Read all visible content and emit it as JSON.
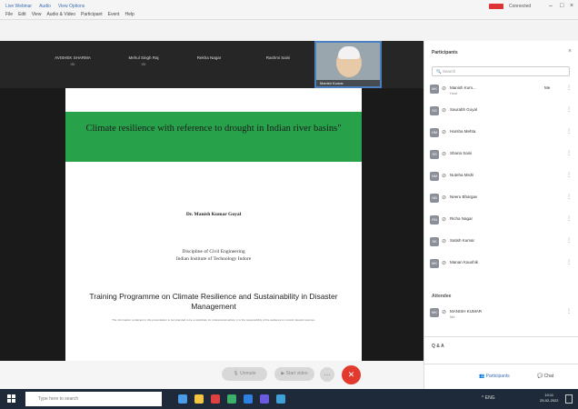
{
  "titlebar": {
    "tabs": [
      "Live Webinar",
      "Audio",
      "View Options"
    ],
    "menu": [
      "File",
      "Edit",
      "View",
      "Audio & Video",
      "Participant",
      "Event",
      "Help"
    ],
    "user": "Connected"
  },
  "video_strip": {
    "tiles": [
      {
        "name": "AVISHEK SHARMA",
        "sub": "ISI"
      },
      {
        "name": "Mehul Singh Raj",
        "sub": "ISI"
      },
      {
        "name": "Rekha Nagar",
        "sub": ""
      },
      {
        "name": "Rashmi Saini",
        "sub": ""
      }
    ],
    "self_name": "Manish Kumar"
  },
  "slide": {
    "title": "Climate resilience with reference to drought in Indian river basins\"",
    "author": "Dr. Manish Kumar Goyal",
    "affiliation_line1": "Discipline of Civil Engineering",
    "affiliation_line2": "Indian Institute of Technology Indore",
    "programme": "Training Programme on Climate Resilience and Sustainability in Disaster Management",
    "fine_print": "The information contained in this presentation is not intended to be a substitute for professional advice; it is the responsibility of the audience to consult relevant sources."
  },
  "controls": {
    "unmute": "Unmute",
    "start_video": "Start video",
    "end_icon": "✕",
    "more_icon": "…"
  },
  "panel": {
    "title": "Participants",
    "search_placeholder": "Search",
    "participants": [
      {
        "name": "Manish Kum...",
        "sub": "Host",
        "initials": "MK",
        "side": "Me"
      },
      {
        "name": "Saurabh Goyal",
        "sub": "",
        "initials": "SG",
        "side": ""
      },
      {
        "name": "Harsha Mehta",
        "sub": "",
        "initials": "HM",
        "side": ""
      },
      {
        "name": "Sharia Saini",
        "sub": "",
        "initials": "SS",
        "side": ""
      },
      {
        "name": "Nuteha Mishi",
        "sub": "",
        "initials": "NM",
        "side": ""
      },
      {
        "name": "Neeru Bhargav",
        "sub": "",
        "initials": "NB",
        "side": ""
      },
      {
        "name": "Richa Nagar",
        "sub": "",
        "initials": "RN",
        "side": ""
      },
      {
        "name": "Satish Kumar",
        "sub": "",
        "initials": "SK",
        "side": ""
      },
      {
        "name": "Manan Kaushik",
        "sub": "",
        "initials": "MK",
        "side": ""
      }
    ],
    "attendee_section": "Attendee",
    "attendee": {
      "name": "MANISH KUMAR",
      "sub": "Me",
      "initials": "MK"
    },
    "qa_label": "Q & A",
    "participants_tab": "Participants",
    "chat_tab": "Chat"
  },
  "taskbar": {
    "search_placeholder": "Type here to search",
    "tray": "^ ENG",
    "time": "10:11",
    "date": "25-02-2022"
  }
}
